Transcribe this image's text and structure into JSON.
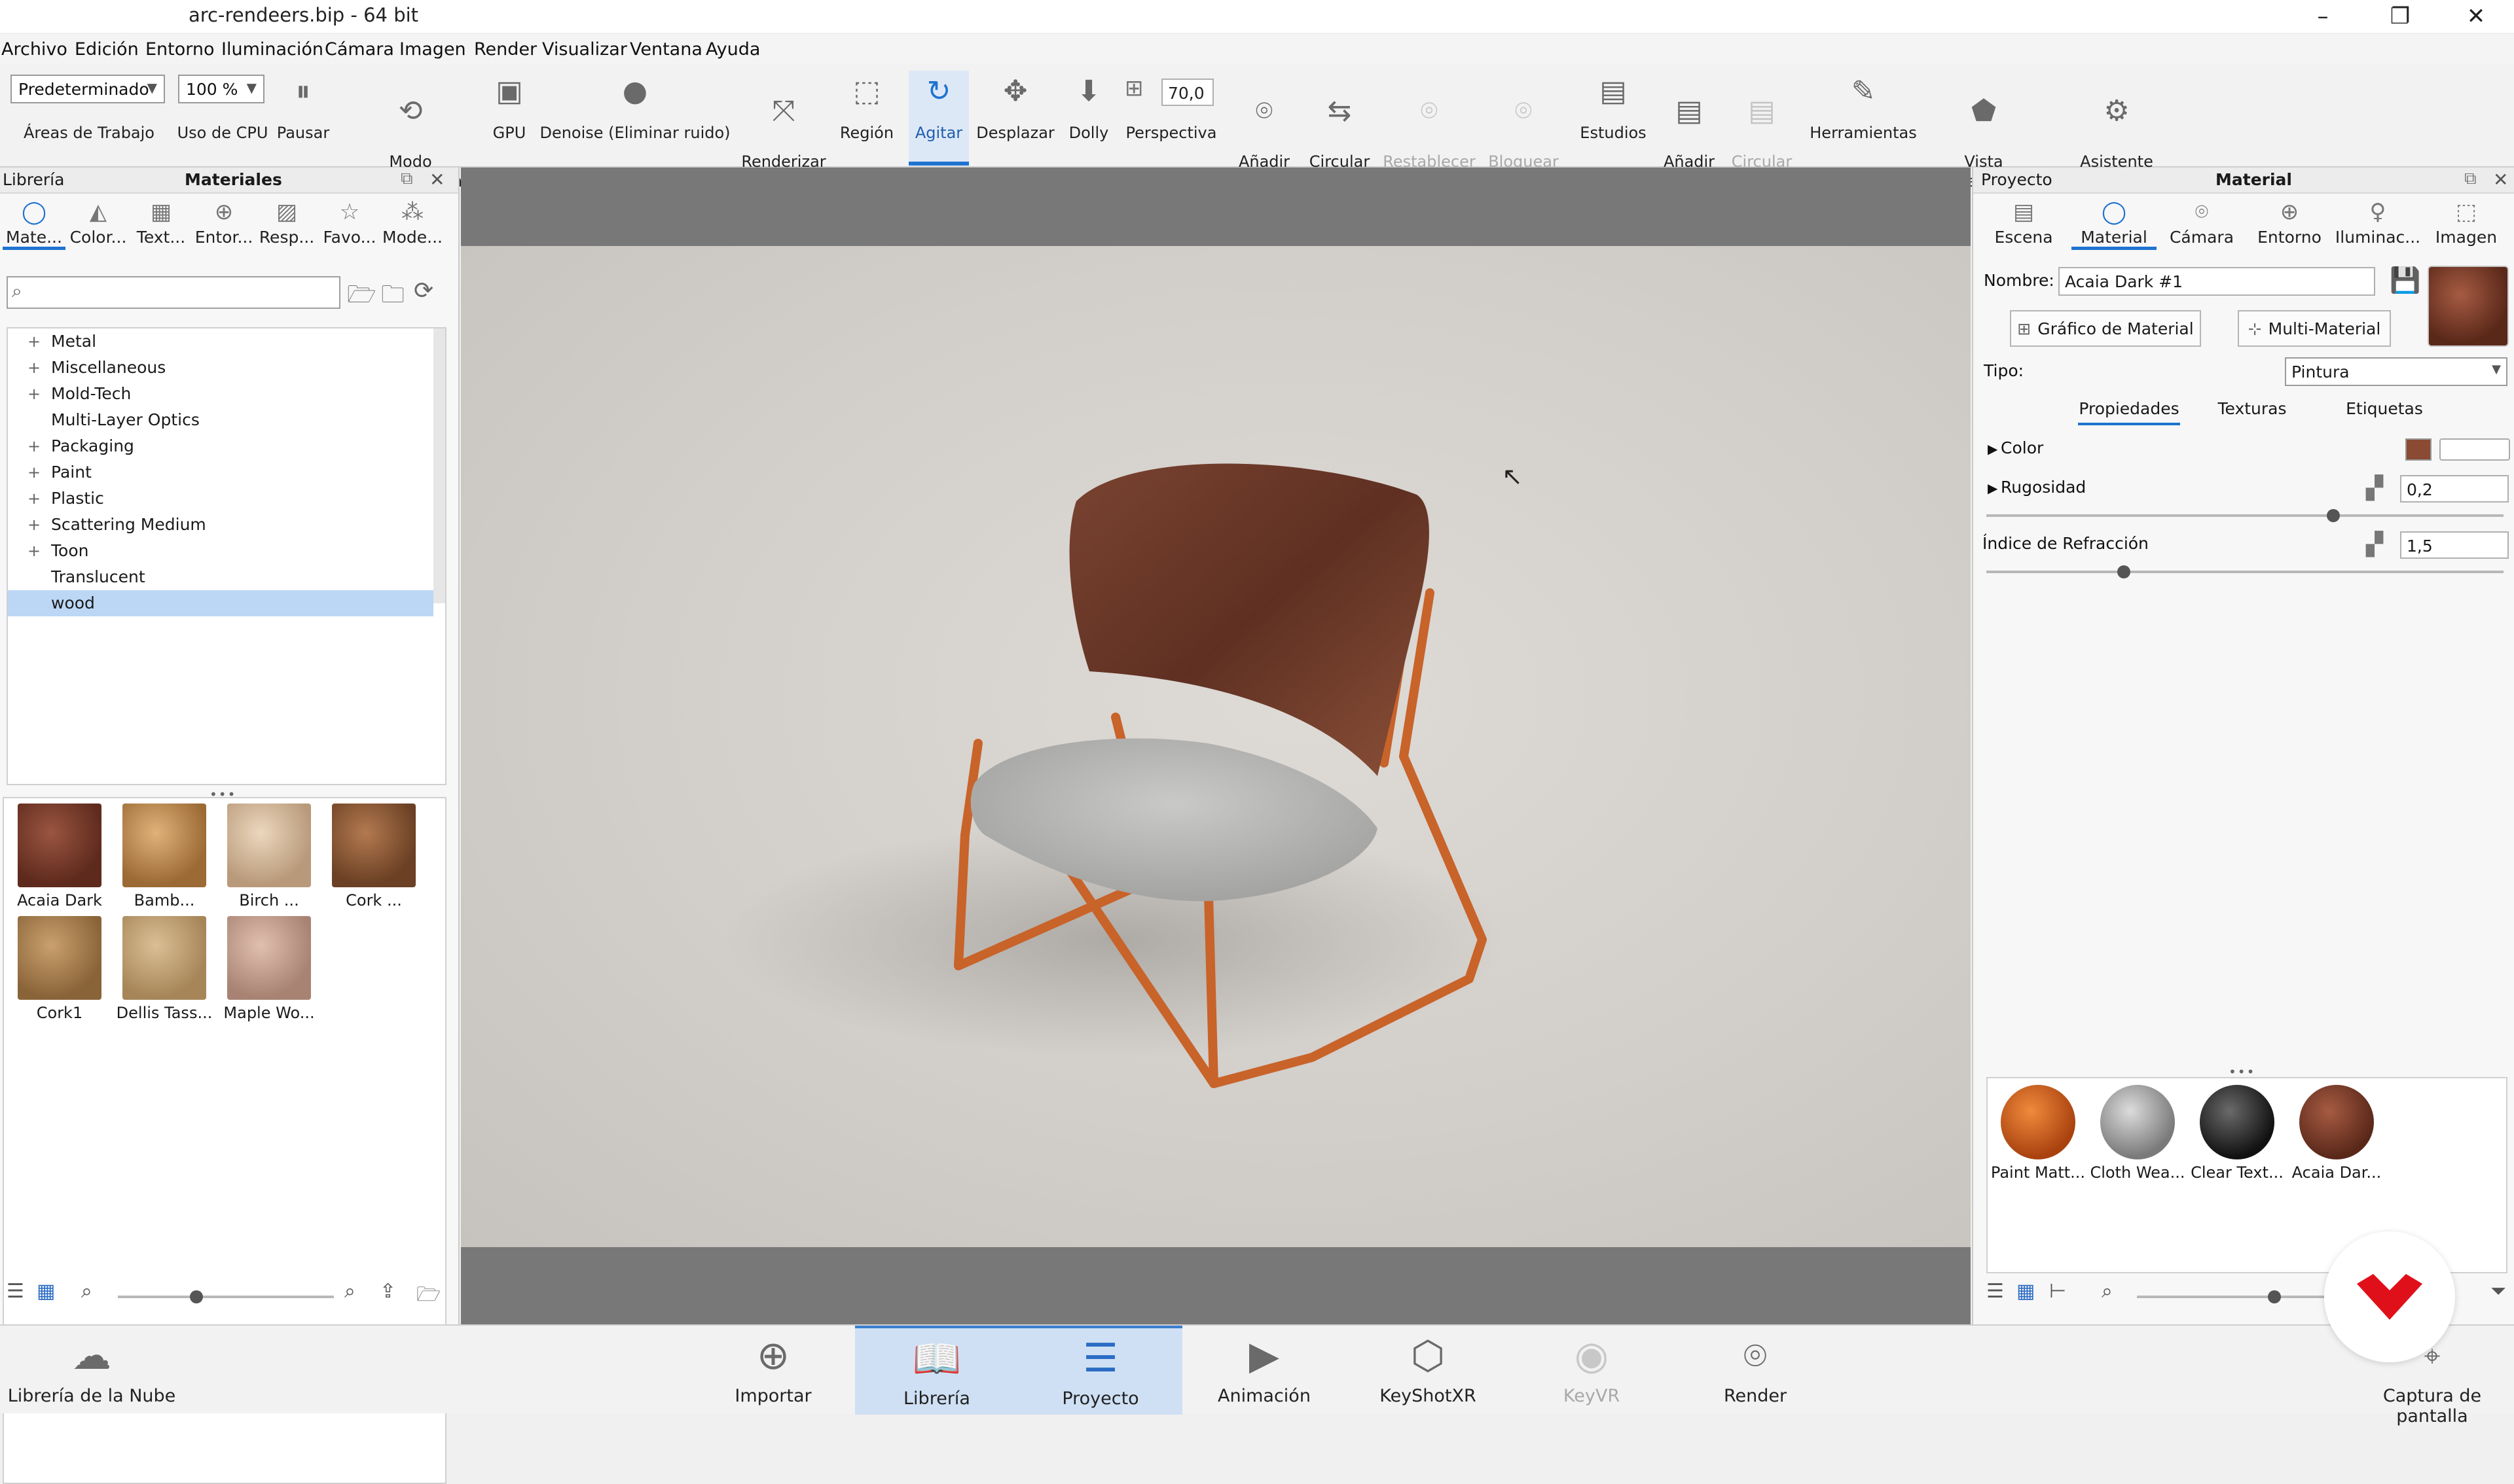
{
  "window": {
    "title": "arc-rendeers.bip  - 64 bit",
    "minimize": "–",
    "maximize": "❐",
    "close": "✕"
  },
  "menu": [
    "Archivo",
    "Edición",
    "Entorno",
    "Iluminación",
    "Cámara",
    "Imagen",
    "Render",
    "Visualizar",
    "Ventana",
    "Ayuda"
  ],
  "toolbar": {
    "workspace_value": "Predeterminado",
    "workspace_label": "Áreas de Trabajo",
    "cpu_value": "100 %",
    "cpu_label": "Uso de CPU",
    "pause": "Pausar",
    "performance": "Modo\nAlto Rendimiento",
    "gpu": "GPU",
    "denoise": "Denoise (Eliminar ruido)",
    "nurbs": "Renderizar\nNURBS",
    "region": "Región",
    "tumble": "Agitar",
    "pan": "Desplazar",
    "dolly": "Dolly",
    "fov_value": "70,0",
    "perspective": "Perspectiva",
    "add_camera": "Añadir\nCámara",
    "cycle_cameras": "Circular\nCámaras",
    "reset_camera": "Restablecer\nCámara",
    "lock_camera": "Bloquear\nCámara",
    "studios": "Estudios",
    "add_studio": "Añadir\nEstudio",
    "cycle_studios": "Circular\nEstudios",
    "tools": "Herramientas",
    "geometry_view": "Vista\nde Geometría",
    "config_wizard": "Asistente\nde Configuración"
  },
  "library": {
    "header_left": "Librería",
    "header_center": "Materiales",
    "tabs": [
      "Mate...",
      "Color...",
      "Text...",
      "Entor...",
      "Resp...",
      "Favo...",
      "Mode..."
    ],
    "tree": [
      "Metal",
      "Miscellaneous",
      "Mold-Tech",
      "Multi-Layer Optics",
      "Packaging",
      "Paint",
      "Plastic",
      "Scattering Medium",
      "Toon",
      "Translucent",
      "wood"
    ],
    "thumbs": [
      "Acaia Dark",
      "Bamb...",
      "Birch ...",
      "Cork ...",
      "Cork1",
      "Dellis Tass...",
      "Maple Wo..."
    ]
  },
  "project": {
    "header_left": "Proyecto",
    "header_center": "Material",
    "tabs": [
      "Escena",
      "Material",
      "Cámara",
      "Entorno",
      "Iluminac...",
      "Imagen"
    ],
    "name_label": "Nombre:",
    "name_value": "Acaia Dark #1",
    "graph_button": "Gráfico de Material",
    "multi_button": "Multi-Material",
    "type_label": "Tipo:",
    "type_value": "Pintura",
    "subtabs": [
      "Propiedades",
      "Texturas",
      "Etiquetas"
    ],
    "color_label": "Color",
    "color_swatch": "#8a4a33",
    "roughness_label": "Rugosidad",
    "roughness_value": "0,2",
    "ior_label": "Índice de Refracción",
    "ior_value": "1,5",
    "scene_materials": [
      "Paint Matt...",
      "Cloth Wea...",
      "Clear Text...",
      "Acaia Dar..."
    ]
  },
  "bottom": {
    "cloud": "Librería de la Nube",
    "import": "Importar",
    "library": "Librería",
    "project": "Proyecto",
    "animation": "Animación",
    "keyshotxr": "KeyShotXR",
    "keyvr": "KeyVR",
    "render": "Render",
    "screenshot": "Captura de pantalla"
  }
}
